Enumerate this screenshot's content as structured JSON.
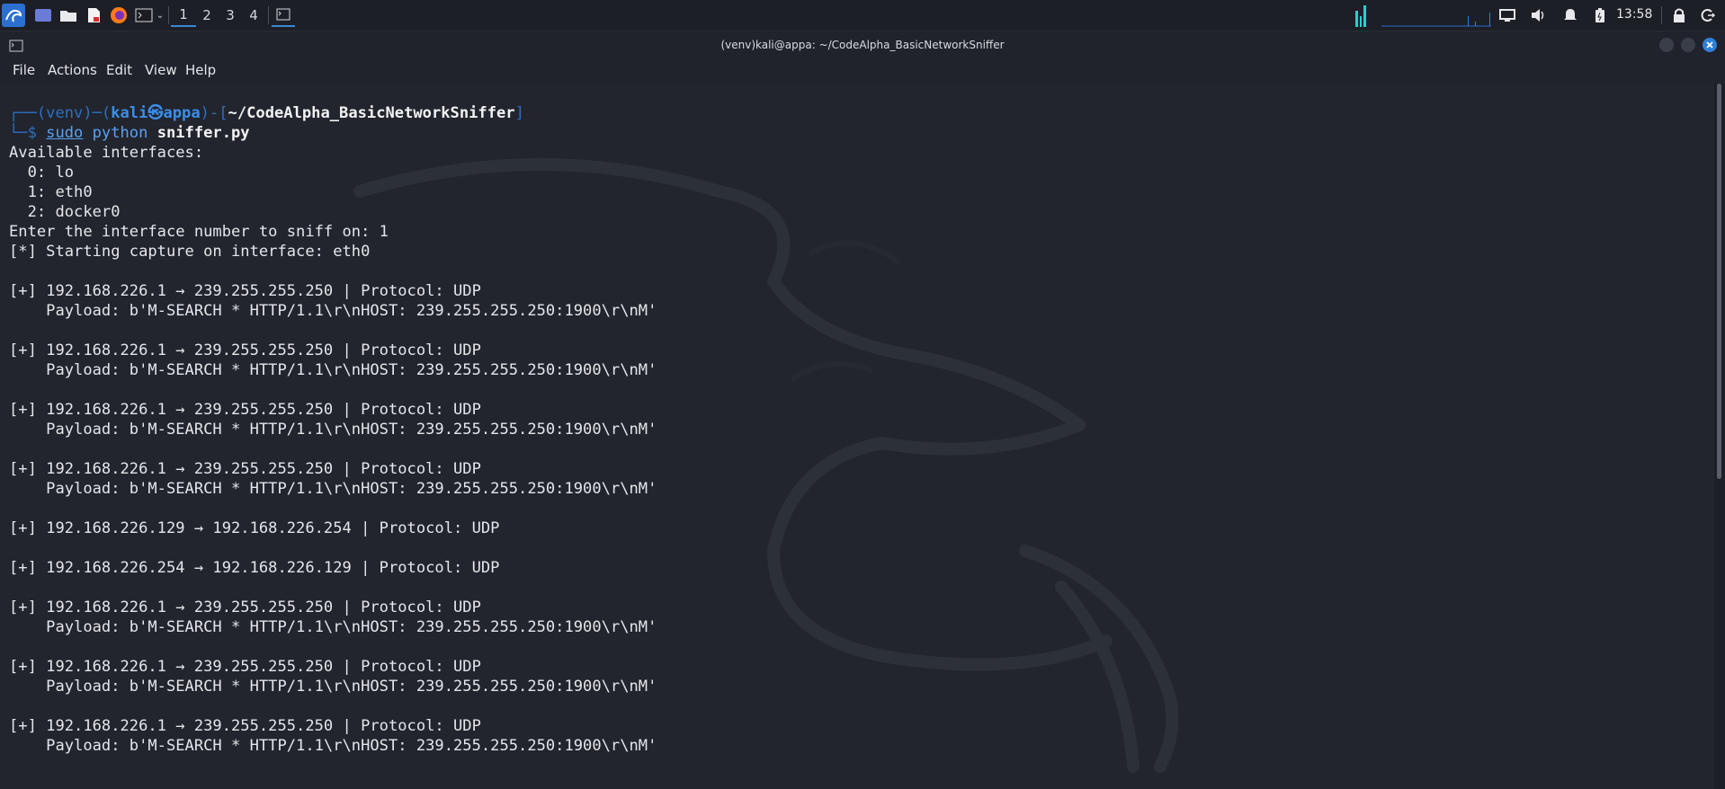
{
  "panel": {
    "workspaces": [
      "1",
      "2",
      "3",
      "4"
    ],
    "clock": "13:58",
    "icons": [
      "kali-menu-icon",
      "desktop-icon",
      "file-manager-icon",
      "text-editor-icon",
      "firefox-icon",
      "terminal-icon",
      "chevron-down-icon",
      "terminal-window-icon",
      "cpu-graph-icon",
      "network-graph-icon",
      "display-icon",
      "volume-icon",
      "notification-bell-icon",
      "battery-icon",
      "lock-icon",
      "logout-icon"
    ]
  },
  "window": {
    "title": "(venv)kali@appa: ~/CodeAlpha_BasicNetworkSniffer",
    "menu": [
      "File",
      "Actions",
      "Edit",
      "View",
      "Help"
    ]
  },
  "terminal": {
    "prompt": {
      "line1_prefix": "┌──(venv)─(",
      "user_host": "kali㉿appa",
      "line1_mid": ")-[",
      "cwd": "~/CodeAlpha_BasicNetworkSniffer",
      "line1_end": "]",
      "line2_prefix": "└─$ ",
      "cmd_sudo": "sudo",
      "cmd_python": " python ",
      "cmd_file": "sniffer.py"
    },
    "output": [
      "Available interfaces:",
      "  0: lo",
      "  1: eth0",
      "  2: docker0",
      "Enter the interface number to sniff on: 1",
      "[*] Starting capture on interface: eth0",
      "",
      "[+] 192.168.226.1 → 239.255.255.250 | Protocol: UDP",
      "    Payload: b'M-SEARCH * HTTP/1.1\\r\\nHOST: 239.255.255.250:1900\\r\\nM'",
      "",
      "[+] 192.168.226.1 → 239.255.255.250 | Protocol: UDP",
      "    Payload: b'M-SEARCH * HTTP/1.1\\r\\nHOST: 239.255.255.250:1900\\r\\nM'",
      "",
      "[+] 192.168.226.1 → 239.255.255.250 | Protocol: UDP",
      "    Payload: b'M-SEARCH * HTTP/1.1\\r\\nHOST: 239.255.255.250:1900\\r\\nM'",
      "",
      "[+] 192.168.226.1 → 239.255.255.250 | Protocol: UDP",
      "    Payload: b'M-SEARCH * HTTP/1.1\\r\\nHOST: 239.255.255.250:1900\\r\\nM'",
      "",
      "[+] 192.168.226.129 → 192.168.226.254 | Protocol: UDP",
      "",
      "[+] 192.168.226.254 → 192.168.226.129 | Protocol: UDP",
      "",
      "[+] 192.168.226.1 → 239.255.255.250 | Protocol: UDP",
      "    Payload: b'M-SEARCH * HTTP/1.1\\r\\nHOST: 239.255.255.250:1900\\r\\nM'",
      "",
      "[+] 192.168.226.1 → 239.255.255.250 | Protocol: UDP",
      "    Payload: b'M-SEARCH * HTTP/1.1\\r\\nHOST: 239.255.255.250:1900\\r\\nM'",
      "",
      "[+] 192.168.226.1 → 239.255.255.250 | Protocol: UDP",
      "    Payload: b'M-SEARCH * HTTP/1.1\\r\\nHOST: 239.255.255.250:1900\\r\\nM'"
    ]
  }
}
